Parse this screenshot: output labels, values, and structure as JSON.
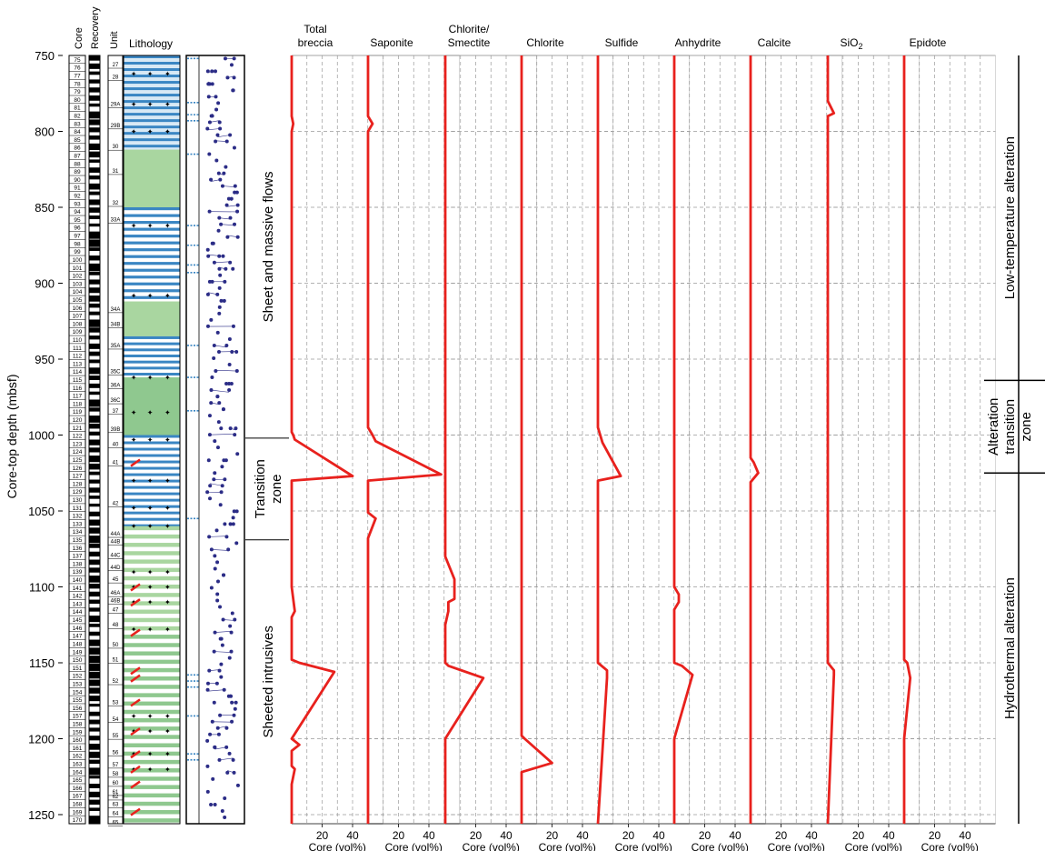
{
  "figure": {
    "y_axis_label": "Core-top depth (mbsf)",
    "column_headers": {
      "core": "Core",
      "recovery": "Recovery",
      "unit": "Unit",
      "lithology": "Lithology"
    },
    "intervals": [
      {
        "label": "Sheet and massive flows",
        "from": 750,
        "to": 1002
      },
      {
        "label": "Transition zone",
        "from": 1002,
        "to": 1069
      },
      {
        "label": "Sheeted intrusives",
        "from": 1069,
        "to": 1256
      }
    ],
    "alteration_zones": [
      {
        "label": "Low-temperature alteration",
        "from": 750,
        "to": 964
      },
      {
        "label": "Alteration transition zone",
        "from": 964,
        "to": 1025
      },
      {
        "label": "Hydrothermal alteration",
        "from": 1025,
        "to": 1256
      }
    ],
    "core_numbers": [
      "75",
      "76",
      "77",
      "78",
      "79",
      "80",
      "81",
      "82",
      "83",
      "84",
      "85",
      "86",
      "87",
      "88",
      "89",
      "90",
      "91",
      "92",
      "93",
      "94",
      "95",
      "96",
      "97",
      "98",
      "99",
      "100",
      "101",
      "102",
      "103",
      "104",
      "105",
      "106",
      "107",
      "108",
      "109",
      "110",
      "111",
      "112",
      "113",
      "114",
      "115",
      "116",
      "117",
      "118",
      "119",
      "120",
      "121",
      "122",
      "123",
      "124",
      "125",
      "126",
      "127",
      "128",
      "129",
      "130",
      "131",
      "132",
      "133",
      "134",
      "135",
      "136",
      "137",
      "138",
      "139",
      "140",
      "141",
      "142",
      "143",
      "144",
      "145",
      "146",
      "147",
      "148",
      "149",
      "150",
      "151",
      "152",
      "153",
      "154",
      "155",
      "156",
      "157",
      "158",
      "159",
      "160",
      "161",
      "162",
      "163",
      "164",
      "165",
      "166",
      "167",
      "168",
      "169",
      "170"
    ],
    "unit_labels": [
      {
        "label": "27",
        "depth": 756
      },
      {
        "label": "28",
        "depth": 764
      },
      {
        "label": "29A",
        "depth": 782
      },
      {
        "label": "29B",
        "depth": 796
      },
      {
        "label": "30",
        "depth": 810
      },
      {
        "label": "31",
        "depth": 826
      },
      {
        "label": "32",
        "depth": 847
      },
      {
        "label": "33A",
        "depth": 858
      },
      {
        "label": "34A",
        "depth": 917
      },
      {
        "label": "34B",
        "depth": 927
      },
      {
        "label": "35A",
        "depth": 941
      },
      {
        "label": "35C",
        "depth": 958
      },
      {
        "label": "36A",
        "depth": 967
      },
      {
        "label": "36C",
        "depth": 977
      },
      {
        "label": "37",
        "depth": 984
      },
      {
        "label": "39B",
        "depth": 996
      },
      {
        "label": "40",
        "depth": 1006
      },
      {
        "label": "41",
        "depth": 1018
      },
      {
        "label": "42",
        "depth": 1045
      },
      {
        "label": "44A",
        "depth": 1065
      },
      {
        "label": "44B",
        "depth": 1070
      },
      {
        "label": "44C",
        "depth": 1079
      },
      {
        "label": "44D",
        "depth": 1087
      },
      {
        "label": "45",
        "depth": 1095
      },
      {
        "label": "46A",
        "depth": 1104
      },
      {
        "label": "46B",
        "depth": 1109
      },
      {
        "label": "47",
        "depth": 1115
      },
      {
        "label": "48",
        "depth": 1125
      },
      {
        "label": "50",
        "depth": 1138
      },
      {
        "label": "51",
        "depth": 1148
      },
      {
        "label": "52",
        "depth": 1162
      },
      {
        "label": "53",
        "depth": 1176
      },
      {
        "label": "54",
        "depth": 1187
      },
      {
        "label": "55",
        "depth": 1198
      },
      {
        "label": "56",
        "depth": 1209
      },
      {
        "label": "57",
        "depth": 1217
      },
      {
        "label": "58",
        "depth": 1223
      },
      {
        "label": "60",
        "depth": 1229
      },
      {
        "label": "61",
        "depth": 1235
      },
      {
        "label": "62",
        "depth": 1238
      },
      {
        "label": "63",
        "depth": 1243
      },
      {
        "label": "64",
        "depth": 1249
      },
      {
        "label": "65",
        "depth": 1255
      }
    ]
  },
  "chart_data": {
    "type": "line",
    "y_axis": {
      "label": "Core-top depth (mbsf)",
      "range": [
        750,
        1256
      ],
      "ticks": [
        750,
        800,
        850,
        900,
        950,
        1000,
        1050,
        1100,
        1150,
        1200,
        1250
      ],
      "inverted": true
    },
    "x_axis": {
      "label": "Core (vol%)",
      "range": [
        0,
        60
      ],
      "ticks": [
        20,
        40
      ]
    },
    "grid": true,
    "series": [
      {
        "name": "Total breccia",
        "points": [
          [
            0,
            750
          ],
          [
            0,
            790
          ],
          [
            1,
            795
          ],
          [
            0,
            800
          ],
          [
            0,
            998
          ],
          [
            1,
            1000
          ],
          [
            2,
            1003
          ],
          [
            40,
            1027
          ],
          [
            0,
            1030
          ],
          [
            0,
            1100
          ],
          [
            2,
            1116
          ],
          [
            0,
            1120
          ],
          [
            0,
            1148
          ],
          [
            5,
            1150
          ],
          [
            28,
            1156
          ],
          [
            0,
            1200
          ],
          [
            5,
            1204
          ],
          [
            0,
            1208
          ],
          [
            0,
            1218
          ],
          [
            2,
            1220
          ],
          [
            0,
            1230
          ],
          [
            0,
            1256
          ]
        ]
      },
      {
        "name": "Saponite",
        "points": [
          [
            0,
            750
          ],
          [
            0,
            790
          ],
          [
            3,
            795
          ],
          [
            0,
            800
          ],
          [
            0,
            995
          ],
          [
            3,
            1000
          ],
          [
            5,
            1004
          ],
          [
            48,
            1026
          ],
          [
            0,
            1030
          ],
          [
            0,
            1051
          ],
          [
            5,
            1055
          ],
          [
            0,
            1068
          ],
          [
            0,
            1256
          ]
        ]
      },
      {
        "name": "Chlorite/Smectite",
        "points": [
          [
            0,
            750
          ],
          [
            0,
            1080
          ],
          [
            6,
            1095
          ],
          [
            6,
            1108
          ],
          [
            2,
            1110
          ],
          [
            2,
            1116
          ],
          [
            0,
            1125
          ],
          [
            0,
            1150
          ],
          [
            2,
            1152
          ],
          [
            25,
            1160
          ],
          [
            0,
            1200
          ],
          [
            0,
            1256
          ]
        ]
      },
      {
        "name": "Chlorite",
        "points": [
          [
            0,
            750
          ],
          [
            0,
            1198
          ],
          [
            2,
            1200
          ],
          [
            20,
            1216
          ],
          [
            0,
            1222
          ],
          [
            0,
            1256
          ]
        ]
      },
      {
        "name": "Sulfide",
        "points": [
          [
            0,
            750
          ],
          [
            0,
            995
          ],
          [
            3,
            1005
          ],
          [
            15,
            1027
          ],
          [
            0,
            1030
          ],
          [
            0,
            1100
          ],
          [
            0,
            1150
          ],
          [
            6,
            1155
          ],
          [
            6,
            1160
          ],
          [
            0,
            1256
          ]
        ]
      },
      {
        "name": "Anhydrite",
        "points": [
          [
            0,
            750
          ],
          [
            0,
            1100
          ],
          [
            3,
            1105
          ],
          [
            3,
            1110
          ],
          [
            0,
            1115
          ],
          [
            0,
            1150
          ],
          [
            5,
            1152
          ],
          [
            12,
            1158
          ],
          [
            0,
            1200
          ],
          [
            0,
            1256
          ]
        ]
      },
      {
        "name": "Calcite",
        "points": [
          [
            0,
            750
          ],
          [
            0,
            1015
          ],
          [
            2,
            1018
          ],
          [
            5,
            1025
          ],
          [
            0,
            1031
          ],
          [
            0,
            1256
          ]
        ]
      },
      {
        "name": "SiO2",
        "points": [
          [
            0,
            750
          ],
          [
            0,
            780
          ],
          [
            4,
            788
          ],
          [
            0,
            790
          ],
          [
            0,
            1150
          ],
          [
            4,
            1155
          ],
          [
            4,
            1158
          ],
          [
            0,
            1256
          ]
        ]
      },
      {
        "name": "Epidote",
        "points": [
          [
            0,
            750
          ],
          [
            0,
            1148
          ],
          [
            2,
            1150
          ],
          [
            4,
            1160
          ],
          [
            0,
            1200
          ],
          [
            0,
            1256
          ]
        ]
      }
    ],
    "panel_titles": [
      {
        "line1": "Total",
        "line2": "breccia"
      },
      {
        "line1": "",
        "line2": "Saponite"
      },
      {
        "line1": "Chlorite/",
        "line2": "Smectite"
      },
      {
        "line1": "",
        "line2": "Chlorite"
      },
      {
        "line1": "",
        "line2": "Sulfide"
      },
      {
        "line1": "",
        "line2": "Anhydrite"
      },
      {
        "line1": "",
        "line2": "Calcite"
      },
      {
        "line1": "",
        "line2": "SiO2"
      },
      {
        "line1": "",
        "line2": "Epidote"
      }
    ],
    "colors": {
      "series": "#e8211d",
      "dike": "#3a86c3",
      "basalt": "#8fc88f",
      "basalt_light": "#a9d6a0",
      "dots": "#2b2c86",
      "grid_dash": "#9a9a9a",
      "grid_solid": "#c8c8c8"
    }
  }
}
